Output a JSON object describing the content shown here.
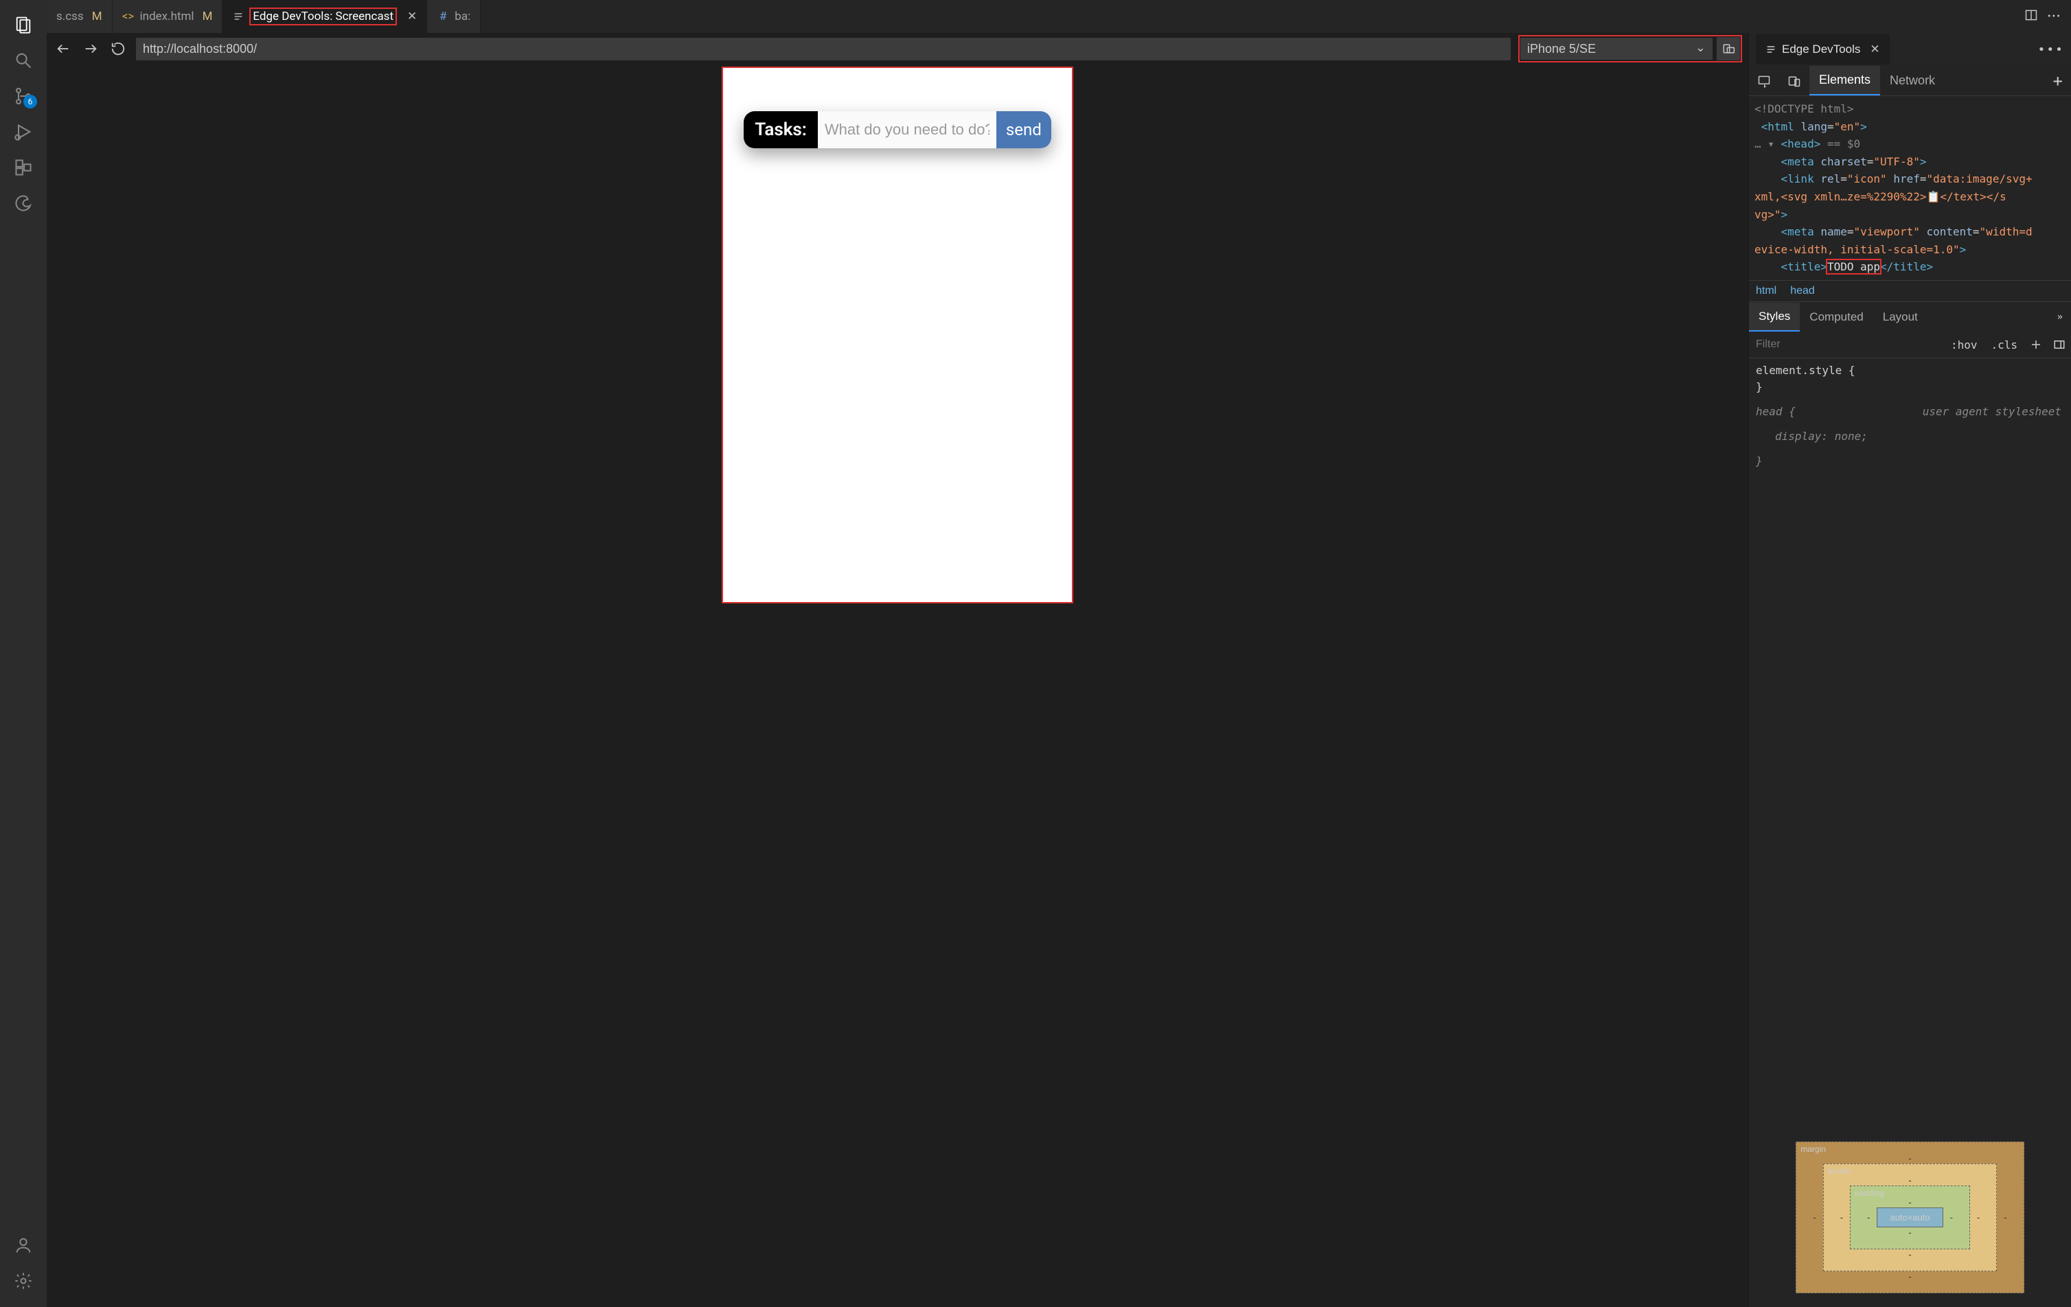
{
  "activityBar": {
    "badgeCount": "6"
  },
  "tabs": {
    "css": {
      "label": "s.css",
      "modified": "M"
    },
    "html": {
      "label": "index.html",
      "modified": "M"
    },
    "screencast": {
      "label": "Edge DevTools: Screencast"
    },
    "bas": {
      "label": "ba:"
    }
  },
  "urlBar": {
    "url": "http://localhost:8000/",
    "device": "iPhone 5/SE"
  },
  "app": {
    "tasksLabel": "Tasks:",
    "placeholder": "What do you need to do?",
    "sendLabel": "send"
  },
  "devtools": {
    "title": "Edge DevTools",
    "mainTabs": {
      "elements": "Elements",
      "network": "Network"
    },
    "dom": {
      "doctype": "<!DOCTYPE html>",
      "htmlOpen1": "<html ",
      "htmlLangAttr": "lang",
      "htmlLangVal": "\"en\"",
      "htmlOpen2": ">",
      "headLine": "<head>",
      "headMeta": " == $0",
      "metaCharset": "<meta charset=\"UTF-8\">",
      "linkLine": "<link rel=\"icon\" href=\"data:image/svg+xml,<svg xmln…ze=%2290%22>📋</text></svg>\">",
      "metaViewport": "<meta name=\"viewport\" content=\"width=device-width, initial-scale=1.0\">",
      "titleOpen": "<title>",
      "titleText": "TODO app",
      "titleClose": "</title>"
    },
    "breadcrumb": {
      "a": "html",
      "b": "head"
    },
    "stylesTabs": {
      "styles": "Styles",
      "computed": "Computed",
      "layout": "Layout"
    },
    "stylesToolbar": {
      "filter": "Filter",
      "hov": ":hov",
      "cls": ".cls"
    },
    "stylesBody": {
      "elementStyle": "element.style {",
      "closeBrace": "}",
      "headSel": "head {",
      "uas": "user agent stylesheet",
      "displayNone": "display: none;"
    },
    "boxModel": {
      "margin": "margin",
      "border": "border",
      "padding": "padding",
      "content": "auto×auto",
      "dash": "-"
    }
  }
}
